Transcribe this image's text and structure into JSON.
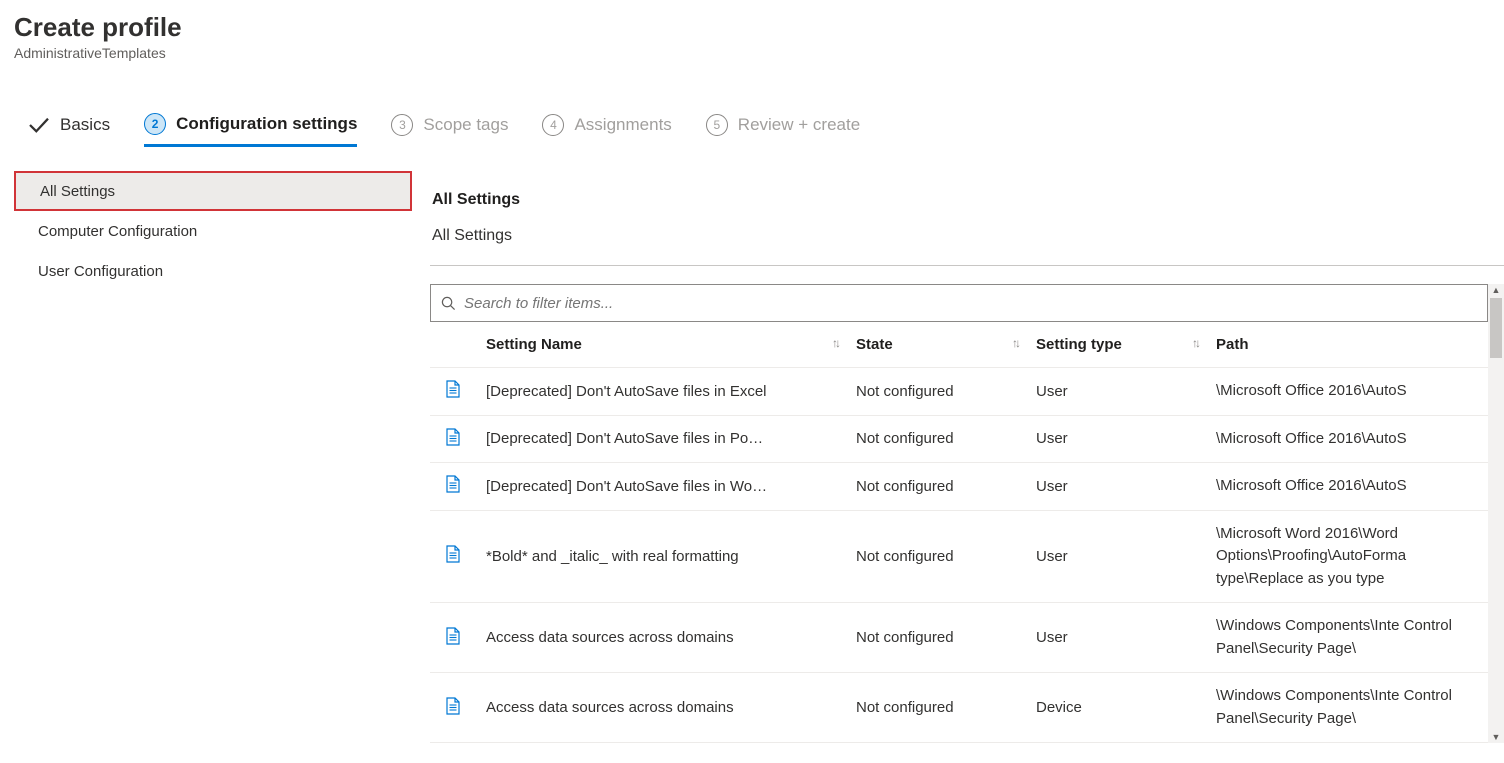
{
  "page": {
    "title": "Create profile",
    "subtitle": "AdministrativeTemplates"
  },
  "wizard": {
    "steps": [
      {
        "label": "Basics",
        "state": "done"
      },
      {
        "num": "2",
        "label": "Configuration settings",
        "state": "active"
      },
      {
        "num": "3",
        "label": "Scope tags",
        "state": "future"
      },
      {
        "num": "4",
        "label": "Assignments",
        "state": "future"
      },
      {
        "num": "5",
        "label": "Review + create",
        "state": "future"
      }
    ]
  },
  "sidebar": {
    "items": [
      {
        "label": "All Settings",
        "selected": true,
        "highlight": true
      },
      {
        "label": "Computer Configuration"
      },
      {
        "label": "User Configuration"
      }
    ]
  },
  "main": {
    "section_title": "All Settings",
    "breadcrumb": "All Settings",
    "search_placeholder": "Search to filter items...",
    "columns": {
      "name": "Setting Name",
      "state": "State",
      "type": "Setting type",
      "path": "Path"
    },
    "rows": [
      {
        "name": "[Deprecated] Don't AutoSave files in Excel",
        "state": "Not configured",
        "type": "User",
        "path": "\\Microsoft Office 2016\\AutoS"
      },
      {
        "name": "[Deprecated] Don't AutoSave files in Po…",
        "state": "Not configured",
        "type": "User",
        "path": "\\Microsoft Office 2016\\AutoS"
      },
      {
        "name": "[Deprecated] Don't AutoSave files in Wo…",
        "state": "Not configured",
        "type": "User",
        "path": "\\Microsoft Office 2016\\AutoS"
      },
      {
        "name": "*Bold* and _italic_ with real formatting",
        "state": "Not configured",
        "type": "User",
        "path": "\\Microsoft Word 2016\\Word Options\\Proofing\\AutoForma type\\Replace as you type"
      },
      {
        "name": "Access data sources across domains",
        "state": "Not configured",
        "type": "User",
        "path": "\\Windows Components\\Inte Control Panel\\Security Page\\"
      },
      {
        "name": "Access data sources across domains",
        "state": "Not configured",
        "type": "Device",
        "path": "\\Windows Components\\Inte Control Panel\\Security Page\\"
      }
    ]
  }
}
